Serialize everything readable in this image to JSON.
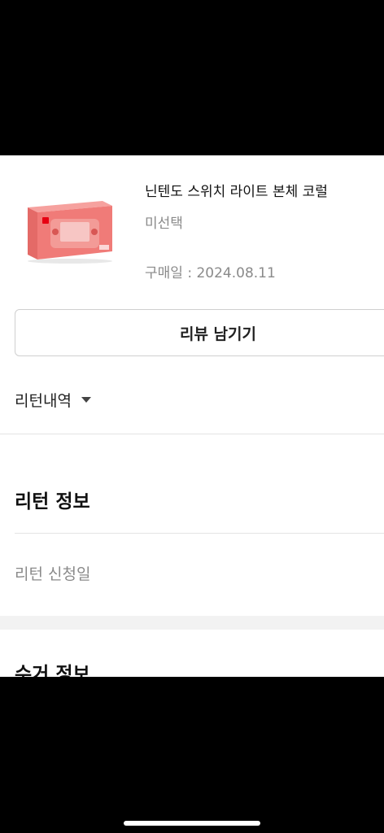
{
  "product": {
    "name": "닌텐도 스위치 라이트 본체 코럴",
    "option": "미선택",
    "purchase_date_label": "구매일 : ",
    "purchase_date": "2024.08.11",
    "image_brand": "Nintendo Switch Lite",
    "box_color": "#f07b78"
  },
  "actions": {
    "review_label": "리뷰 남기기"
  },
  "return_history": {
    "label": "리턴내역"
  },
  "return_info": {
    "title": "리턴 정보",
    "fields": [
      {
        "label": "리턴 신청일"
      }
    ]
  },
  "pickup_info": {
    "title": "수거 정보"
  }
}
